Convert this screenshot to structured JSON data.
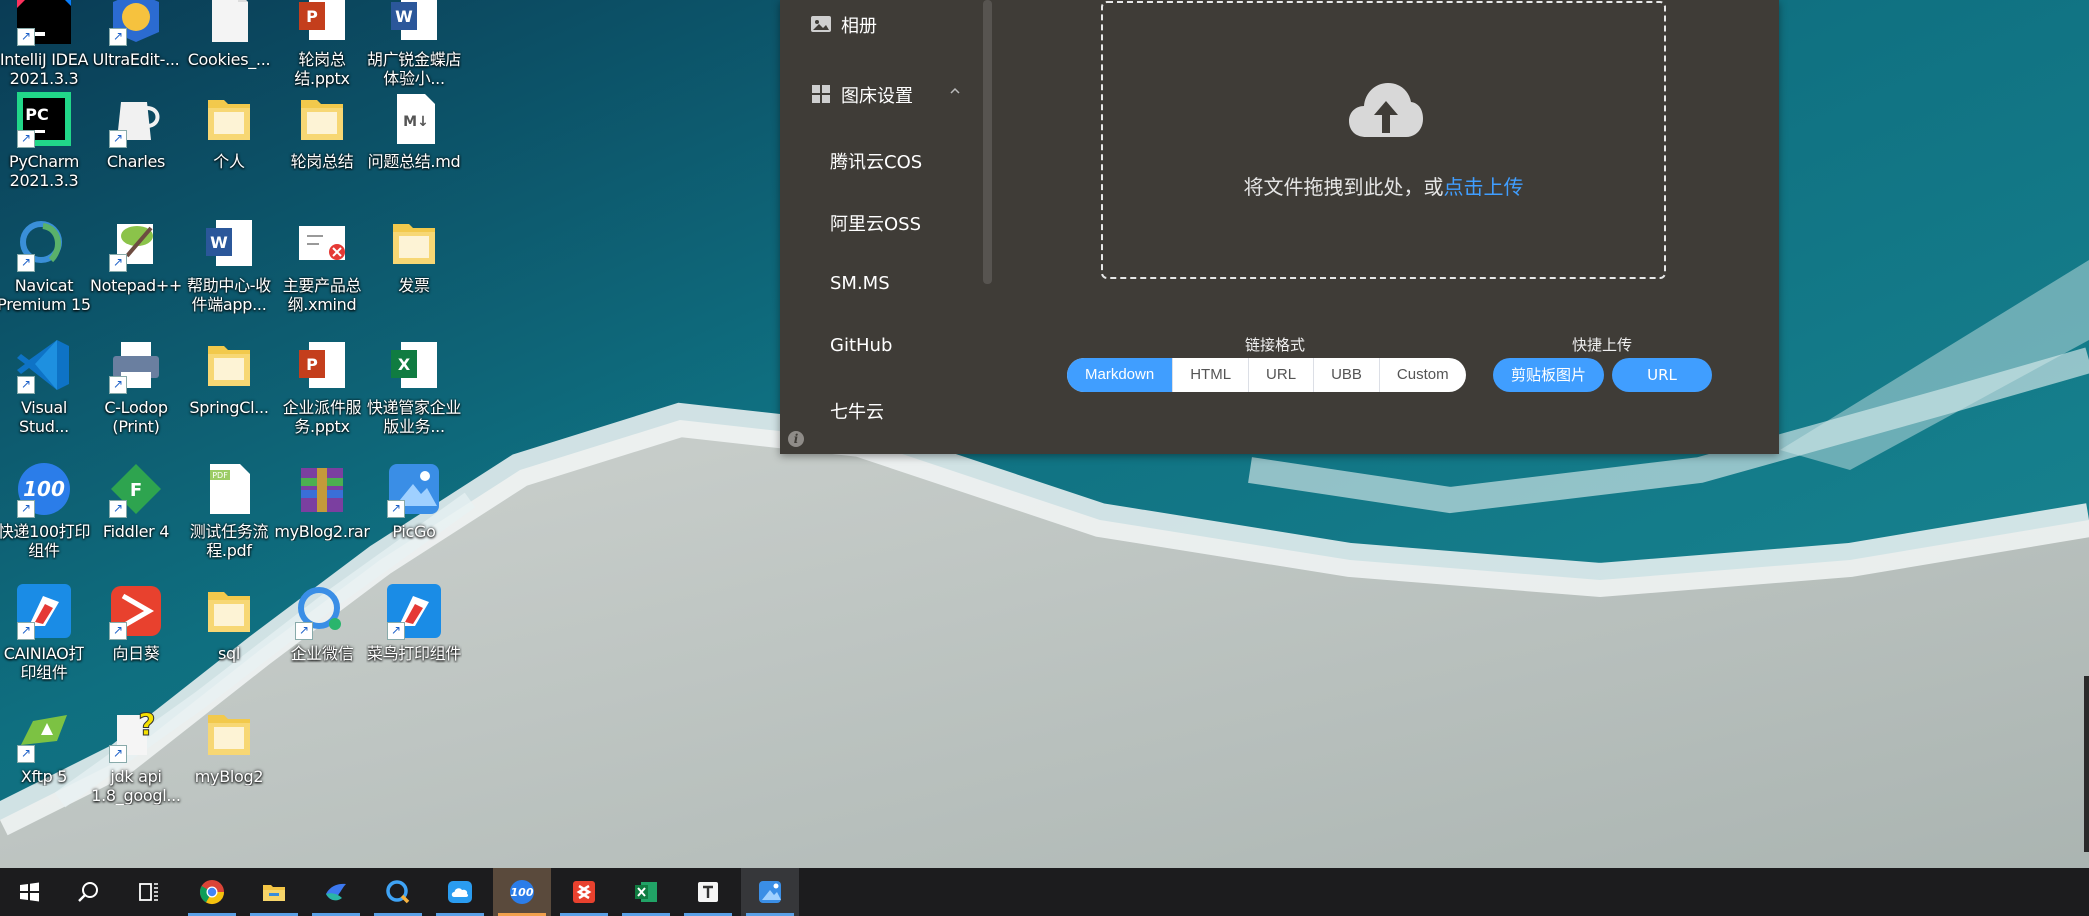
{
  "desktop": {
    "icons": [
      {
        "label": "IntelliJ IDEA 2021.3.3",
        "icon": "intellij-icon"
      },
      {
        "label": "UltraEdit-...",
        "icon": "ultraedit-icon"
      },
      {
        "label": "Cookies_...",
        "icon": "file-icon"
      },
      {
        "label": "轮岗总结.pptx",
        "icon": "powerpoint-icon"
      },
      {
        "label": "胡广锐金蝶店体验小...",
        "icon": "word-icon"
      },
      {
        "label": "PyCharm 2021.3.3",
        "icon": "pycharm-icon"
      },
      {
        "label": "Charles",
        "icon": "charles-icon"
      },
      {
        "label": "个人",
        "icon": "folder-icon"
      },
      {
        "label": "轮岗总结",
        "icon": "folder-icon"
      },
      {
        "label": "问题总结.md",
        "icon": "markdown-icon"
      },
      {
        "label": "Navicat Premium 15",
        "icon": "navicat-icon"
      },
      {
        "label": "Notepad++",
        "icon": "notepadpp-icon"
      },
      {
        "label": "帮助中心-收件端app...",
        "icon": "word-icon"
      },
      {
        "label": "主要产品总纲.xmind",
        "icon": "xmind-icon"
      },
      {
        "label": "发票",
        "icon": "folder-icon"
      },
      {
        "label": "Visual Stud...",
        "icon": "vscode-icon"
      },
      {
        "label": "C-Lodop (Print)",
        "icon": "printer-icon"
      },
      {
        "label": "SpringCl...",
        "icon": "folder-icon"
      },
      {
        "label": "企业派件服务.pptx",
        "icon": "powerpoint-icon"
      },
      {
        "label": "快递管家企业版业务...",
        "icon": "excel-icon"
      },
      {
        "label": "快递100打印组件",
        "icon": "kuaidi100-icon"
      },
      {
        "label": "Fiddler 4",
        "icon": "fiddler-icon"
      },
      {
        "label": "测试任务流程.pdf",
        "icon": "pdf-icon"
      },
      {
        "label": "myBlog2.rar",
        "icon": "winrar-icon"
      },
      {
        "label": "PicGo",
        "icon": "picgo-icon"
      },
      {
        "label": "CAINIAO打印组件",
        "icon": "cainiao-icon"
      },
      {
        "label": "向日葵",
        "icon": "sunlogin-icon"
      },
      {
        "label": "sql",
        "icon": "folder-icon"
      },
      {
        "label": "企业微信",
        "icon": "wecom-icon"
      },
      {
        "label": "菜鸟打印组件",
        "icon": "cainiao-icon"
      },
      {
        "label": "Xftp 5",
        "icon": "xftp-icon"
      },
      {
        "label": "jdk api 1.8_googl...",
        "icon": "chm-icon"
      },
      {
        "label": "myBlog2",
        "icon": "folder-icon"
      }
    ]
  },
  "picgo": {
    "sidebar": {
      "album": "相册",
      "pic_settings": "图床设置",
      "providers": [
        "腾讯云COS",
        "阿里云OSS",
        "SM.MS",
        "GitHub",
        "七牛云"
      ]
    },
    "upload": {
      "drop_text": "将文件拖拽到此处，或",
      "click_upload": "点击上传"
    },
    "link_format": {
      "label": "链接格式",
      "options": [
        "Markdown",
        "HTML",
        "URL",
        "UBB",
        "Custom"
      ],
      "selected": "Markdown"
    },
    "quick_upload": {
      "label": "快捷上传",
      "clipboard": "剪贴板图片",
      "url": "URL"
    },
    "accent_color": "#409eff"
  },
  "taskbar": {
    "items": [
      "start-icon",
      "search-icon",
      "task-view-icon",
      "chrome-icon",
      "file-explorer-icon",
      "lark-icon",
      "qq-browser-icon",
      "cloud-icon",
      "kuaidi100-icon",
      "sunlogin-icon",
      "excel-icon",
      "typora-icon",
      "picgo-icon"
    ]
  }
}
